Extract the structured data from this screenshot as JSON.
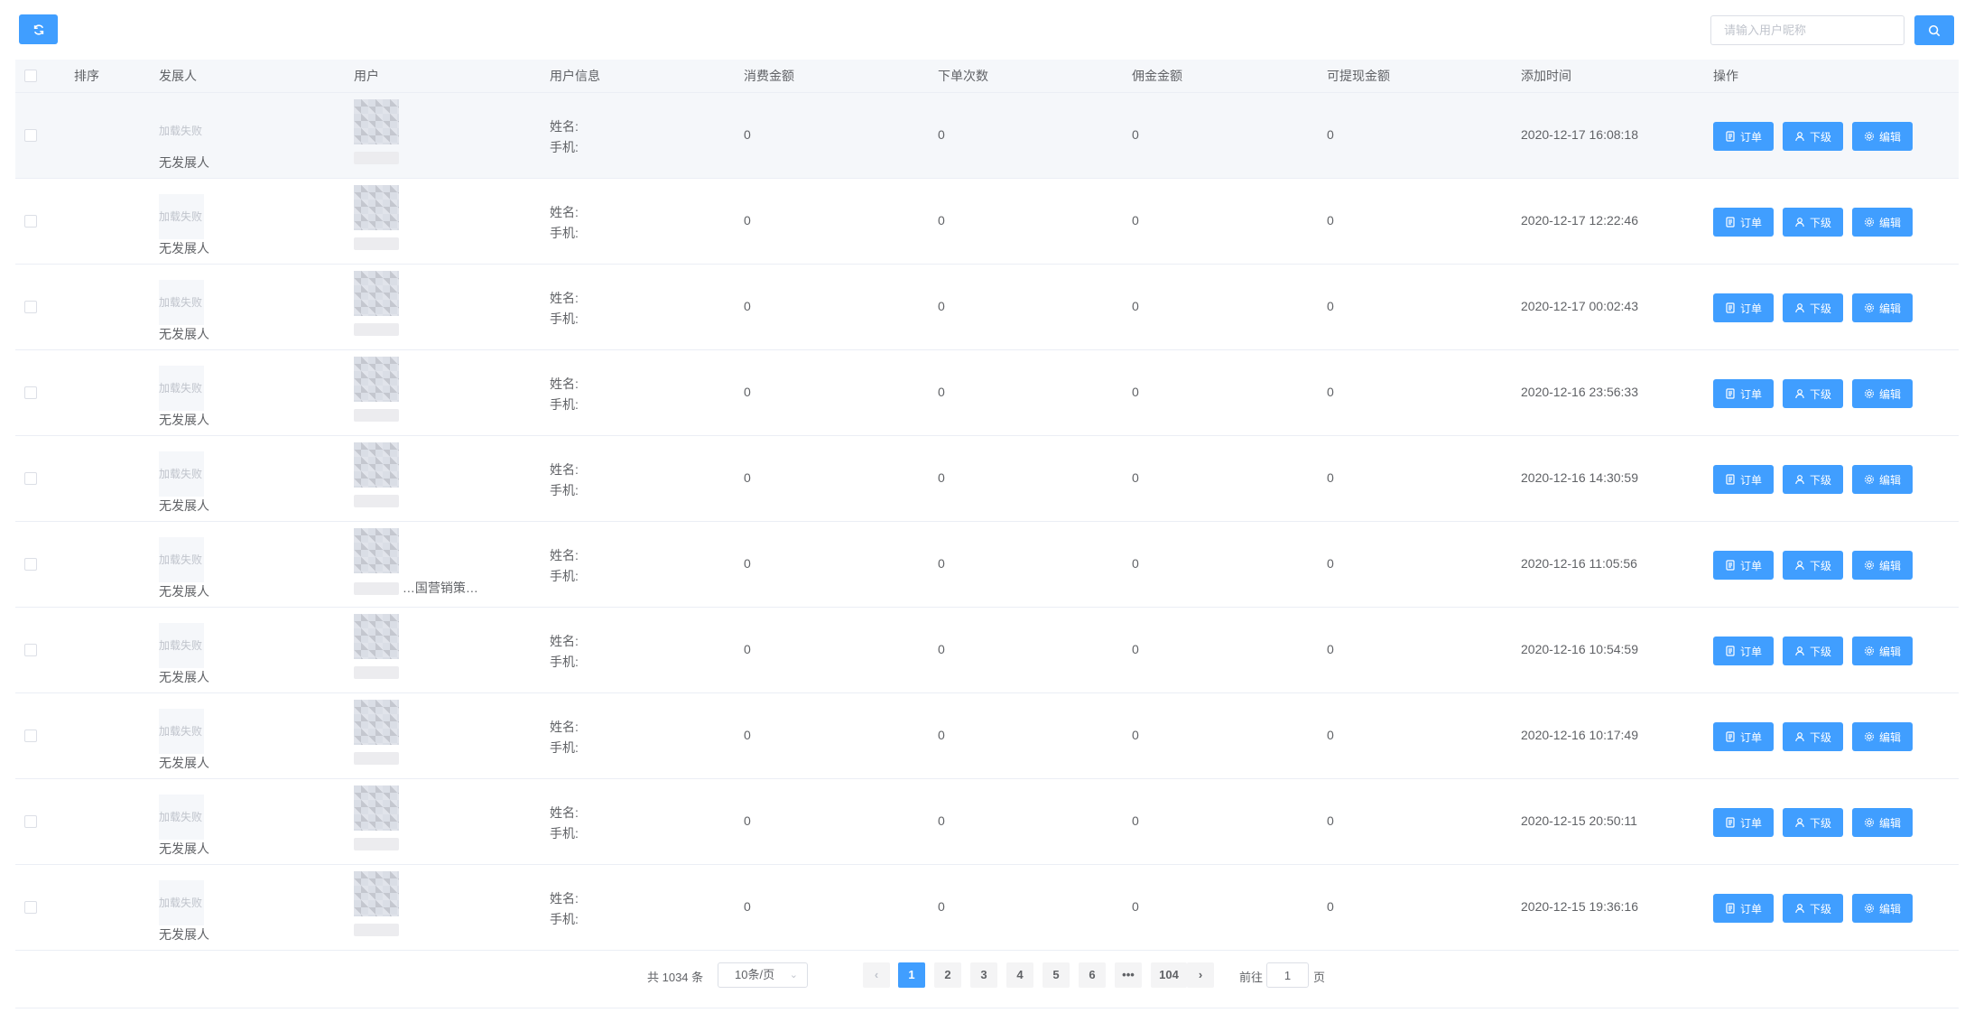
{
  "toolbar": {
    "search_placeholder": "请输入用户昵称"
  },
  "colors": {
    "primary": "#409eff",
    "header_bg": "#f5f7fa",
    "border": "#ebeef5",
    "text": "#606266",
    "placeholder": "#c0c4cc"
  },
  "icons": {
    "refresh": "refresh-icon",
    "search": "search-icon",
    "order": "document-icon",
    "sub": "user-icon",
    "edit": "gear-icon"
  },
  "table": {
    "headers": [
      "排序",
      "发展人",
      "用户",
      "用户信息",
      "消费金额",
      "下单次数",
      "佣金金额",
      "可提现金额",
      "添加时间",
      "操作"
    ],
    "rows": [
      {
        "ref_avatar": "加载失败",
        "ref_name": "无发展人",
        "user_name": "",
        "name_label": "姓名:",
        "phone_label": "手机:",
        "consume": "0",
        "orders": "0",
        "commission": "0",
        "withdrawable": "0",
        "created": "2020-12-17 16:08:18"
      },
      {
        "ref_avatar": "加载失败",
        "ref_name": "无发展人",
        "user_name": "",
        "name_label": "姓名:",
        "phone_label": "手机:",
        "consume": "0",
        "orders": "0",
        "commission": "0",
        "withdrawable": "0",
        "created": "2020-12-17 12:22:46"
      },
      {
        "ref_avatar": "加载失败",
        "ref_name": "无发展人",
        "user_name": "",
        "name_label": "姓名:",
        "phone_label": "手机:",
        "consume": "0",
        "orders": "0",
        "commission": "0",
        "withdrawable": "0",
        "created": "2020-12-17 00:02:43"
      },
      {
        "ref_avatar": "加载失败",
        "ref_name": "无发展人",
        "user_name": "",
        "name_label": "姓名:",
        "phone_label": "手机:",
        "consume": "0",
        "orders": "0",
        "commission": "0",
        "withdrawable": "0",
        "created": "2020-12-16 23:56:33"
      },
      {
        "ref_avatar": "加载失败",
        "ref_name": "无发展人",
        "user_name": "",
        "name_label": "姓名:",
        "phone_label": "手机:",
        "consume": "0",
        "orders": "0",
        "commission": "0",
        "withdrawable": "0",
        "created": "2020-12-16 14:30:59"
      },
      {
        "ref_avatar": "加载失败",
        "ref_name": "无发展人",
        "user_name": "…国营销策…",
        "name_label": "姓名:",
        "phone_label": "手机:",
        "consume": "0",
        "orders": "0",
        "commission": "0",
        "withdrawable": "0",
        "created": "2020-12-16 11:05:56"
      },
      {
        "ref_avatar": "加载失败",
        "ref_name": "无发展人",
        "user_name": "",
        "name_label": "姓名:",
        "phone_label": "手机:",
        "consume": "0",
        "orders": "0",
        "commission": "0",
        "withdrawable": "0",
        "created": "2020-12-16 10:54:59"
      },
      {
        "ref_avatar": "加载失败",
        "ref_name": "无发展人",
        "user_name": "",
        "name_label": "姓名:",
        "phone_label": "手机:",
        "consume": "0",
        "orders": "0",
        "commission": "0",
        "withdrawable": "0",
        "created": "2020-12-16 10:17:49"
      },
      {
        "ref_avatar": "加载失败",
        "ref_name": "无发展人",
        "user_name": "",
        "name_label": "姓名:",
        "phone_label": "手机:",
        "consume": "0",
        "orders": "0",
        "commission": "0",
        "withdrawable": "0",
        "created": "2020-12-15 20:50:11"
      },
      {
        "ref_avatar": "加载失败",
        "ref_name": "无发展人",
        "user_name": "",
        "name_label": "姓名:",
        "phone_label": "手机:",
        "consume": "0",
        "orders": "0",
        "commission": "0",
        "withdrawable": "0",
        "created": "2020-12-15 19:36:16"
      }
    ],
    "actions": {
      "order": "订单",
      "sub": "下级",
      "edit": "编辑"
    }
  },
  "pagination": {
    "total": "共 1034 条",
    "page_size": "10条/页",
    "prev": "‹",
    "next": "›",
    "pages": [
      "1",
      "2",
      "3",
      "4",
      "5",
      "6",
      "•••",
      "104"
    ],
    "current": "1",
    "goto_label": "前往",
    "goto_value": "1",
    "goto_suffix": "页"
  }
}
